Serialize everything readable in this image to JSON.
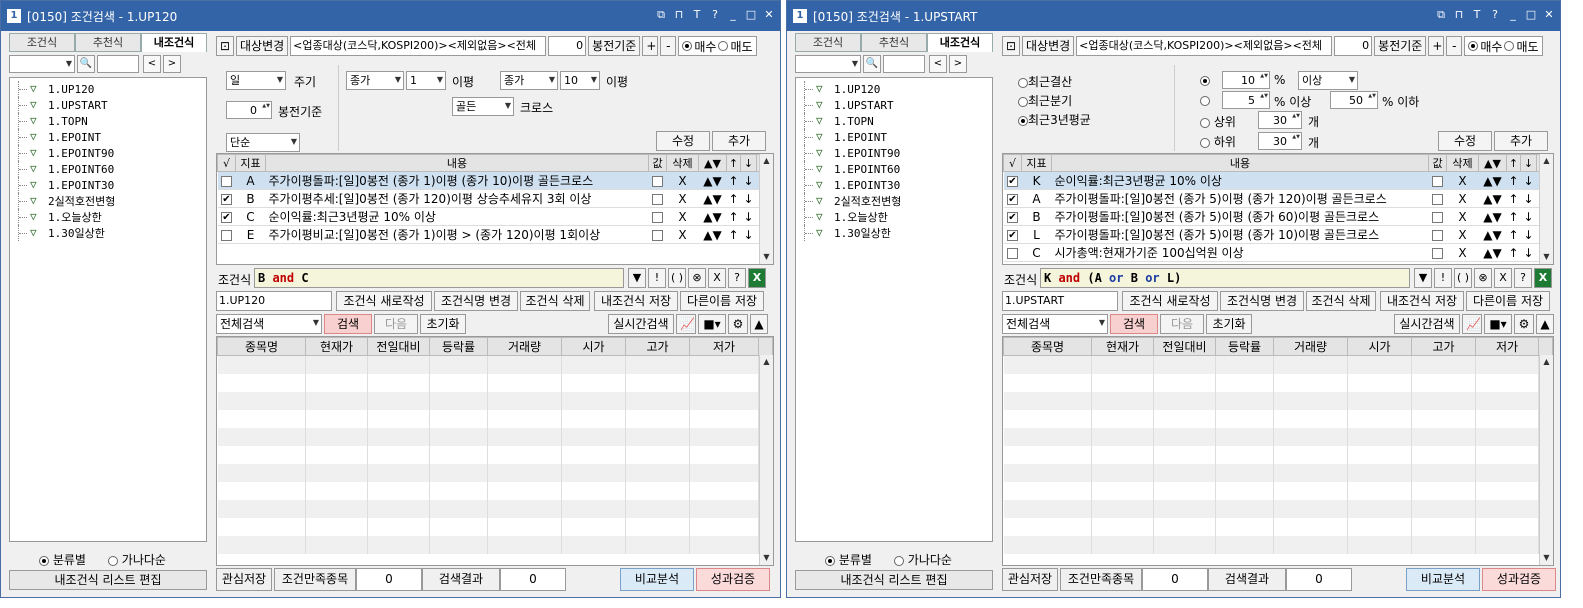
{
  "windows": [
    {
      "title": "[0150] 조건검색 - 1.UP120",
      "left": {
        "tabs": [
          "조건식",
          "추천식",
          "내조건식"
        ],
        "active_tab": 2,
        "tree": [
          "1.UP120",
          "1.UPSTART",
          "1.TOPN",
          "1.EPOINT",
          "1.EPOINT90",
          "1.EPOINT60",
          "1.EPOINT30",
          "2실적호전변형",
          "1.오늘상한",
          "1.30일상한"
        ],
        "radio1": "분류별",
        "radio2": "가나다순",
        "edit_btn": "내조건식 리스트 편집"
      },
      "toolbar": {
        "target_btn": "대상변경",
        "target_text": "<업종대상(코스닥,KOSPI200)><제외없음><전체",
        "spin": "0",
        "bong": "봉전기준",
        "plus": "+",
        "minus": "-",
        "buy": "매수",
        "sell": "매도"
      },
      "opts": {
        "period": "일",
        "period_label": "주기",
        "bongjeon_val": "0",
        "bongjeon_label": "봉전기준",
        "mode": "단순",
        "p1": "종가",
        "n1": "1",
        "ipyeong1": "이평",
        "p2": "종가",
        "n2": "10",
        "ipyeong2": "이평",
        "cross": "골든",
        "cross_label": "크로스",
        "modify": "수정",
        "add": "추가"
      },
      "cond_header": [
        "√",
        "지표",
        "내용",
        "값",
        "삭제",
        "▲▼",
        "↑",
        "↓"
      ],
      "conditions": [
        {
          "chk": false,
          "sel": true,
          "id": "A",
          "text": "주가이평돌파:[일]0봉전 (종가 1)이평 (종가 10)이평 골든크로스"
        },
        {
          "chk": true,
          "sel": false,
          "id": "B",
          "text": "주가이평추세:[일]0봉전 (종가 120)이평 상승추세유지 3회 이상"
        },
        {
          "chk": true,
          "sel": false,
          "id": "C",
          "text": "순이익률:최근3년평균 10% 이상"
        },
        {
          "chk": false,
          "sel": false,
          "id": "E",
          "text": "주가이평비교:[일]0봉전 (종가 1)이평 > (종가 120)이평 1회이상"
        }
      ],
      "formula_label": "조건식",
      "formula": [
        {
          "t": "B",
          "c": ""
        },
        {
          "t": " and ",
          "c": "and"
        },
        {
          "t": "C",
          "c": ""
        }
      ],
      "formula_btns": [
        "▼",
        "!",
        "( )",
        "⊗",
        "X",
        "?",
        "X"
      ],
      "name": "1.UP120",
      "row3": [
        "조건식 새로작성",
        "조건식명 변경",
        "조건식 삭제",
        "내조건식 저장",
        "다른이름 저장"
      ],
      "row4": {
        "scope": "전체검색",
        "search": "검색",
        "next": "다음",
        "reset": "초기화",
        "realtime": "실시간검색"
      },
      "result_cols": [
        "종목명",
        "현재가",
        "전일대비",
        "등락률",
        "거래량",
        "시가",
        "고가",
        "저가"
      ],
      "bottom": {
        "save": "관심저장",
        "satisfy": "조건만족종목",
        "satisfy_val": "0",
        "result": "검색결과",
        "result_val": "0",
        "compare": "비교분석",
        "verify": "성과검증"
      }
    },
    {
      "title": "[0150] 조건검색 - 1.UPSTART",
      "left": {
        "tabs": [
          "조건식",
          "추천식",
          "내조건식"
        ],
        "active_tab": 2,
        "tree": [
          "1.UP120",
          "1.UPSTART",
          "1.TOPN",
          "1.EPOINT",
          "1.EPOINT90",
          "1.EPOINT60",
          "1.EPOINT30",
          "2실적호전변형",
          "1.오늘상한",
          "1.30일상한"
        ],
        "radio1": "분류별",
        "radio2": "가나다순",
        "edit_btn": "내조건식 리스트 편집"
      },
      "toolbar": {
        "target_btn": "대상변경",
        "target_text": "<업종대상(코스닥,KOSPI200)><제외없음><전체",
        "spin": "0",
        "bong": "봉전기준",
        "plus": "+",
        "minus": "-",
        "buy": "매수",
        "sell": "매도"
      },
      "opts2": {
        "r1": "최근결산",
        "r2": "최근분기",
        "r3": "최근3년평균",
        "v1": "10",
        "pct": "%",
        "cmp": "이상",
        "v2": "5",
        "pct_over": "% 이상",
        "v3": "50",
        "pct_under": "% 이하",
        "top": "상위",
        "top_v": "30",
        "bottom": "하위",
        "bottom_v": "30",
        "unit": "개",
        "modify": "수정",
        "add": "추가"
      },
      "cond_header": [
        "√",
        "지표",
        "내용",
        "값",
        "삭제",
        "▲▼",
        "↑",
        "↓"
      ],
      "conditions": [
        {
          "chk": true,
          "sel": true,
          "id": "K",
          "text": "순이익률:최근3년평균 10% 이상"
        },
        {
          "chk": true,
          "sel": false,
          "id": "A",
          "text": "주가이평돌파:[일]0봉전 (종가 5)이평 (종가 120)이평 골든크로스"
        },
        {
          "chk": true,
          "sel": false,
          "id": "B",
          "text": "주가이평돌파:[일]0봉전 (종가 5)이평 (종가 60)이평 골든크로스"
        },
        {
          "chk": true,
          "sel": false,
          "id": "L",
          "text": "주가이평돌파:[일]0봉전 (종가 5)이평 (종가 10)이평 골든크로스"
        },
        {
          "chk": false,
          "sel": false,
          "id": "C",
          "text": "시가총액:현재가기준 100십억원 이상"
        }
      ],
      "formula_label": "조건식",
      "formula": [
        {
          "t": "K",
          "c": ""
        },
        {
          "t": " and ",
          "c": "and"
        },
        {
          "t": "(",
          "c": ""
        },
        {
          "t": "A",
          "c": ""
        },
        {
          "t": " or ",
          "c": "or"
        },
        {
          "t": "B",
          "c": ""
        },
        {
          "t": " or ",
          "c": "or"
        },
        {
          "t": "L",
          "c": ""
        },
        {
          "t": ")",
          "c": ""
        }
      ],
      "formula_btns": [
        "▼",
        "!",
        "( )",
        "⊗",
        "X",
        "?",
        "X"
      ],
      "name": "1.UPSTART",
      "row3": [
        "조건식 새로작성",
        "조건식명 변경",
        "조건식 삭제",
        "내조건식 저장",
        "다른이름 저장"
      ],
      "row4": {
        "scope": "전체검색",
        "search": "검색",
        "next": "다음",
        "reset": "초기화",
        "realtime": "실시간검색"
      },
      "result_cols": [
        "종목명",
        "현재가",
        "전일대비",
        "등락률",
        "거래량",
        "시가",
        "고가",
        "저가"
      ],
      "bottom": {
        "save": "관심저장",
        "satisfy": "조건만족종목",
        "satisfy_val": "0",
        "result": "검색결과",
        "result_val": "0",
        "compare": "비교분석",
        "verify": "성과검증"
      }
    }
  ],
  "titlebar_icons": [
    "restore-icon",
    "pin-icon",
    "font-icon",
    "help-icon",
    "minimize-icon",
    "maximize-icon",
    "close-icon"
  ],
  "titlebar_glyphs": [
    "⧉",
    "⊓",
    "T",
    "?",
    "_",
    "□",
    "✕"
  ],
  "app_icon": "1"
}
